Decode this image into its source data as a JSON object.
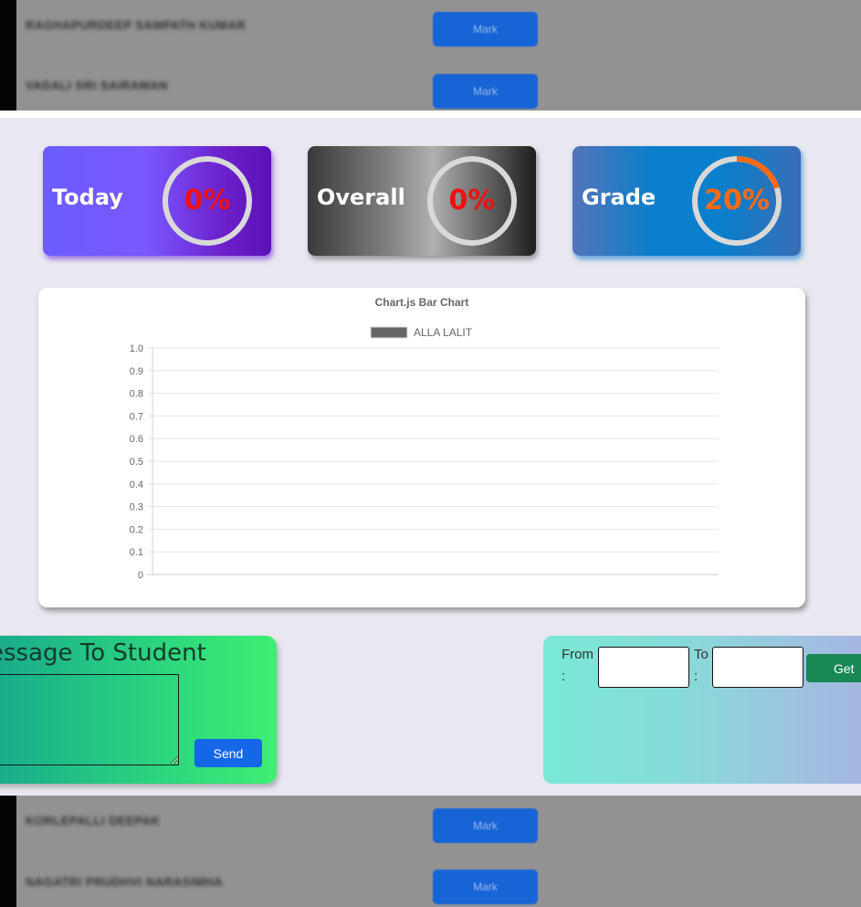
{
  "background_list": {
    "top_rows": [
      {
        "name": "RAGHAPURDEEP SAMPATH KUMAR",
        "button": "Mark"
      },
      {
        "name": "VADALI SRI SAIRAMAN",
        "button": "Mark"
      }
    ],
    "bottom_rows": [
      {
        "name": "KORLEPALLI DEEPAK",
        "button": "Mark"
      },
      {
        "name": "NAGATRI PRUDHVI NARASIMHA",
        "button": "Mark"
      }
    ]
  },
  "stats": {
    "today": {
      "label": "Today",
      "value_text": "0%",
      "percent": 0,
      "text_color": "#ee1111",
      "arc_color": "#ff6a13"
    },
    "overall": {
      "label": "Overall",
      "value_text": "0%",
      "percent": 0,
      "text_color": "#ee1111",
      "arc_color": "#ff6a13"
    },
    "grade": {
      "label": "Grade",
      "value_text": "20%",
      "percent": 20,
      "text_color": "#ff6a13",
      "arc_color": "#ff6a13"
    }
  },
  "chart_data": {
    "type": "bar",
    "title": "Chart.js Bar Chart",
    "series": [
      {
        "name": "ALLA LALIT",
        "values": []
      }
    ],
    "categories": [],
    "ylim": [
      0,
      1.0
    ],
    "yticks": [
      "1.0",
      "0.9",
      "0.8",
      "0.7",
      "0.6",
      "0.5",
      "0.4",
      "0.3",
      "0.2",
      "0.1",
      "0"
    ],
    "grid": true,
    "legend_position": "top",
    "series_color": "#666666"
  },
  "message": {
    "title": "essage To Student",
    "textarea_value": "",
    "send_label": "Send"
  },
  "date_range": {
    "from_label_line1": "From",
    "from_label_line2": ":",
    "to_label_line1": "To",
    "to_label_line2": ":",
    "from_value": "",
    "to_value": "",
    "get_label": "Get"
  },
  "colors": {
    "ring_track": "#d9d9d9",
    "send_button": "#1468e8",
    "get_button": "#198754"
  }
}
